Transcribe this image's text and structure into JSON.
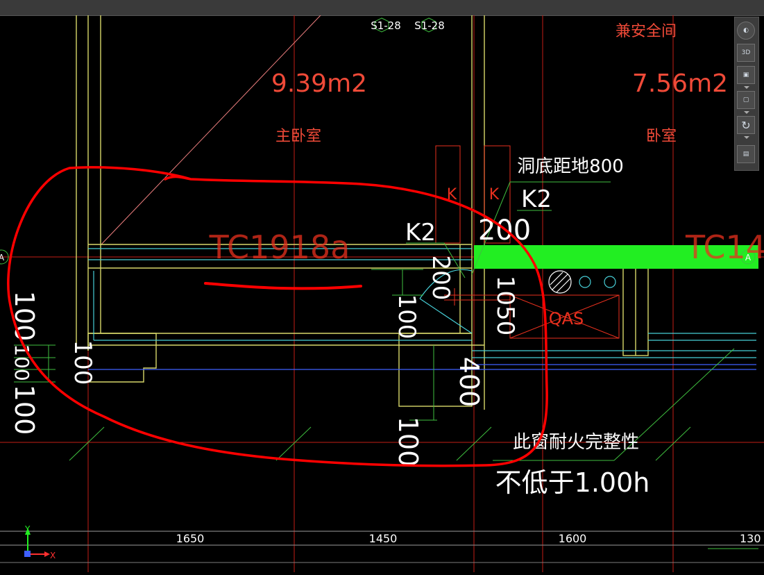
{
  "grid_refs": {
    "left": "S1-28",
    "right": "S1-28"
  },
  "axis_bubble_left": "A",
  "axis_bubble_right": "A",
  "rooms": [
    {
      "name": "主卧室",
      "area": "9.39m2"
    },
    {
      "name": "卧室",
      "area": "7.56m2"
    }
  ],
  "room_top_right_label": "兼安全间",
  "window_labels": {
    "main": "TC1918a",
    "partial": "TC14"
  },
  "opening_note": "洞底距地800",
  "k_labels": {
    "k2_right": "K2",
    "k2_left": "K2",
    "k_small_1": "K",
    "k_small_2": "K"
  },
  "equipment_label": "QAS",
  "dimensions": {
    "d_200_top": "200",
    "d_200_vertical": "200",
    "d_100_center": "100",
    "d_100_mid": "100",
    "d_100_left_a": "100",
    "d_100_left_b": "100",
    "d_100_left_c": "100",
    "d_1050": "1050",
    "d_400": "400",
    "d_100_bottom": "100"
  },
  "fire_note": {
    "line1": "此窗耐火完整性",
    "line2": "不低于1.00h"
  },
  "ruler": {
    "values": [
      "1650",
      "1450",
      "1600",
      "130"
    ]
  },
  "ucs": {
    "x": "X",
    "y": "Y"
  },
  "viewcube": {
    "btn_3d": "3D"
  },
  "colors": {
    "background": "#000000",
    "wall": "#d8d86a",
    "axis_red": "#e8301e",
    "text_red": "#f04a38",
    "window_cyan": "#47cfd7",
    "highlight_green": "#22ee22",
    "dim_green": "#3fbf3f",
    "text_white": "#ffffff",
    "annotation_red": "#ff0000",
    "grey_line": "#7d7d7d",
    "blue_line": "#3f5fff"
  }
}
